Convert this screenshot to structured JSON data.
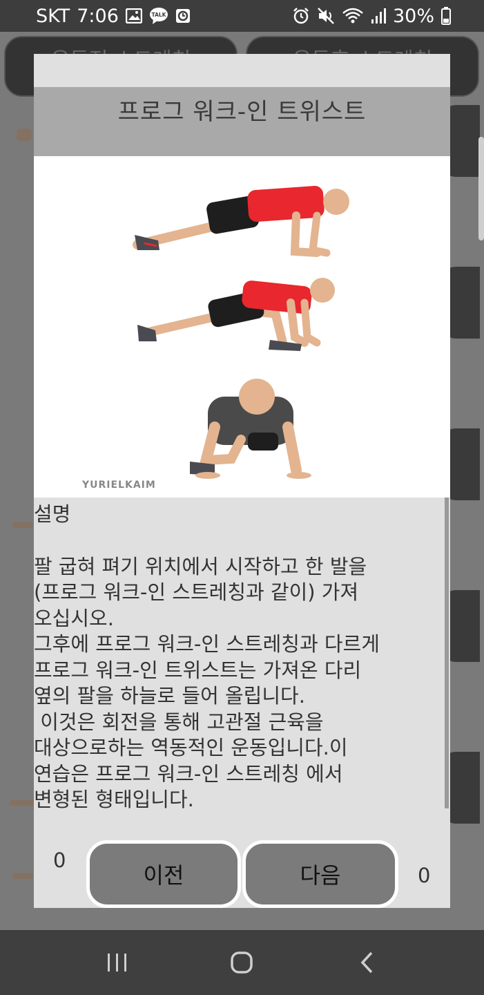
{
  "status_bar": {
    "carrier": "SKT",
    "time": "7:06",
    "talk_badge": "TALK",
    "battery": "30%"
  },
  "background": {
    "tab_left": "운동전 스트레칭",
    "tab_right": "운동후 스트레칭"
  },
  "dialog": {
    "title": "프로그 워크-인 트위스트",
    "watermark": "YURIELKAIM",
    "description_label": "설명",
    "description_text": "팔 굽혀 펴기 위치에서 시작하고 한 발을\n(프로그 워크-인 스트레칭과 같이) 가져\n오십시오.\n그후에 프로그 워크-인 스트레칭과 다르게\n프로그 워크-인 트위스트는 가져온 다리\n옆의 팔을 하늘로 들어 올립니다.\n 이것은 회전을 통해 고관절 근육을\n대상으로하는 역동적인 운동입니다.이\n연습은 프로그 워크-인 스트레칭 에서\n변형된 형태입니다.",
    "counter_left": "0",
    "counter_right": "0",
    "prev_label": "이전",
    "next_label": "다음"
  },
  "colors": {
    "status_bar": "#3d3d3d",
    "dialog_bg": "#e0e0e0",
    "title_bar": "#a9a9a9",
    "button_bg": "#7b7b7b",
    "shirt_red": "#e8272e",
    "shirt_gray": "#4a4a4a"
  },
  "icons": [
    "gallery-icon",
    "talk-icon",
    "clock-app-icon",
    "alarm-icon",
    "mute-icon",
    "wifi-icon",
    "signal-icon",
    "battery-icon",
    "recent-apps-icon",
    "home-icon",
    "back-icon"
  ]
}
